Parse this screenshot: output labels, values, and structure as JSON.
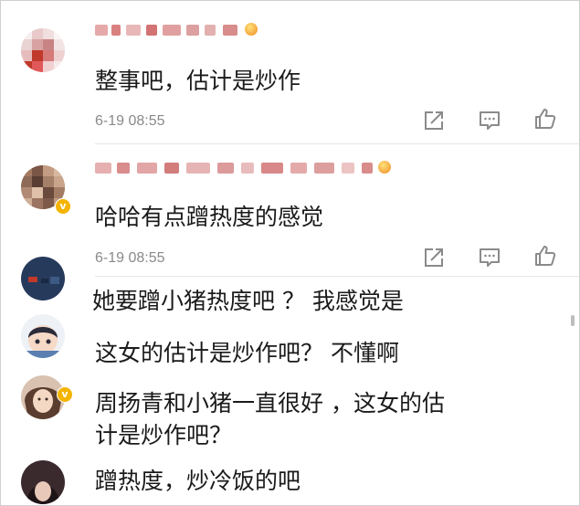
{
  "comments": [
    {
      "text": "整事吧，估计是炒作",
      "time": "6-19 08:55"
    },
    {
      "text": "哈哈有点蹭热度的感觉",
      "time": "6-19 08:55"
    }
  ],
  "replies": [
    {
      "text": "她要蹭小猪热度吧 ？ 我感觉是"
    },
    {
      "text": "这女的估计是炒作吧？ 不懂啊"
    },
    {
      "line1": "周扬青和小猪一直很好 ，这女的估",
      "line2": "计是炒作吧？"
    },
    {
      "text": "蹭热度，炒冷饭的吧"
    }
  ],
  "icons": {
    "share": "share-icon",
    "comment": "comment-icon",
    "like": "like-icon",
    "verified": "verified-badge-icon"
  },
  "colors": {
    "text": "#1a1a1a",
    "time": "#8a8a8a",
    "icon": "#8a8a8a",
    "badge": "#f4b400"
  }
}
